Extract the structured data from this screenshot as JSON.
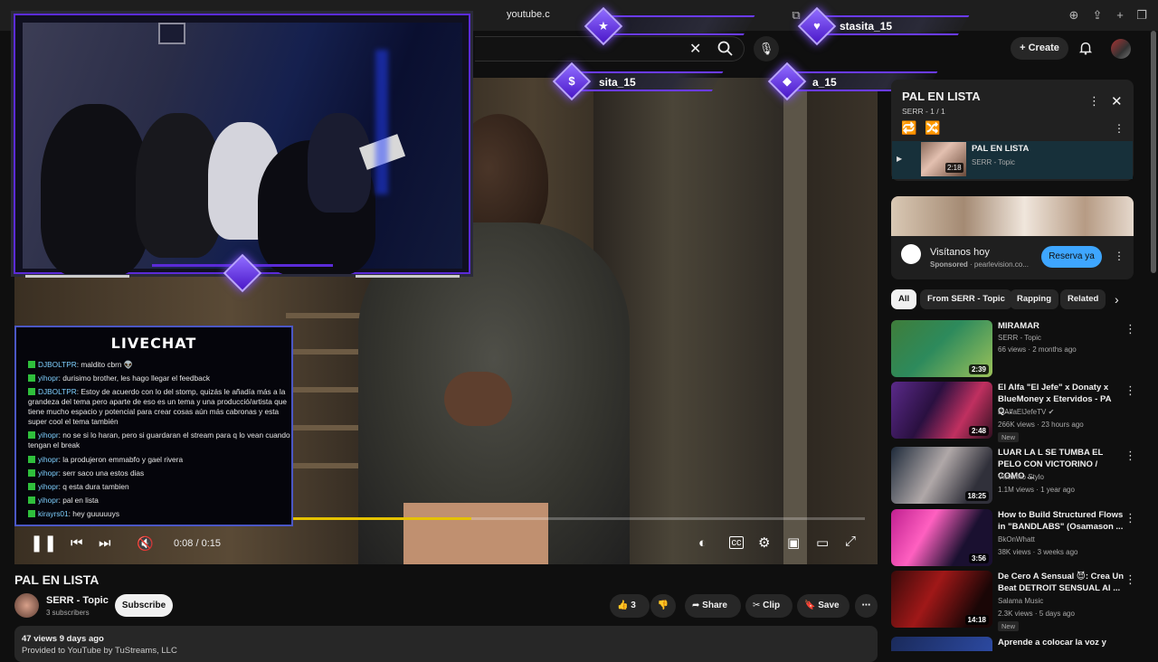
{
  "browser": {
    "url": "youtube.c"
  },
  "header": {
    "create_label": "Create"
  },
  "player": {
    "time": "0:08 / 0:15",
    "progress": 0.53
  },
  "video": {
    "title": "PAL EN LISTA",
    "channel": "SERR - Topic",
    "subscribers": "3 subscribers",
    "subscribe_label": "Subscribe",
    "likes": "3",
    "share_label": "Share",
    "clip_label": "Clip",
    "save_label": "Save",
    "desc_meta": "47 views  9 days ago",
    "desc_line": "Provided to YouTube by TuStreams, LLC"
  },
  "overlay": {
    "alerts": [
      "stasita_15",
      "sita_15",
      "a_15"
    ],
    "chat_title": "LIVECHAT",
    "chat": [
      {
        "user": "DJBOLTPR",
        "msg": "maldito cbrn 👽"
      },
      {
        "user": "yihopr",
        "msg": "durisimo brother, les hago llegar el feedback"
      },
      {
        "user": "DJBOLTPR",
        "msg": "Estoy de acuerdo con lo del stomp, quizás le añadía más a la grandeza del tema pero aparte de eso es un tema y una producció/artista que tiene mucho espacio y potencial para crear cosas aún más cabronas y esta super cool el tema también"
      },
      {
        "user": "yihopr",
        "msg": "no se si lo haran, pero si guardaran el stream para q lo vean cuando tengan el break"
      },
      {
        "user": "yihopr",
        "msg": "la produjeron emmabfo y gael rivera"
      },
      {
        "user": "yihopr",
        "msg": "serr saco una estos dias"
      },
      {
        "user": "yihopr",
        "msg": "q esta dura tambien"
      },
      {
        "user": "yihopr",
        "msg": "pal en lista"
      },
      {
        "user": "kirayrs01",
        "msg": "hey guuuuuys"
      }
    ]
  },
  "playlist": {
    "title": "PAL EN LISTA",
    "sub": "SERR - 1 / 1",
    "item_title": "PAL EN LISTA",
    "item_channel": "SERR - Topic",
    "item_duration": "2:18"
  },
  "ad": {
    "title": "Visítanos hoy",
    "sponsored": "Sponsored",
    "domain": " · pearlevision.co...",
    "cta": "Reserva ya"
  },
  "chips": [
    "All",
    "From SERR - Topic",
    "Rapping",
    "Related"
  ],
  "recommendations": [
    {
      "title": "MIRAMAR",
      "channel": "SERR - Topic",
      "meta": "66 views · 2 months ago",
      "duration": "2:39",
      "badge": ""
    },
    {
      "title": "El Alfa \"El Jefe\" x Donaty x BlueMoney x Etervidos - PA Q...",
      "channel": "ElAlfaElJefeTV ✔",
      "meta": "266K views · 23 hours ago",
      "duration": "2:48",
      "badge": "New"
    },
    {
      "title": "LUAR LA L SE TUMBA EL PELO CON VICTORINO / COMO ...",
      "channel": "Victorino Stylo",
      "meta": "1.1M views · 1 year ago",
      "duration": "18:25",
      "badge": ""
    },
    {
      "title": "How to Build Structured Flows in \"BANDLABS\" (Osamason ...",
      "channel": "BkOnWhatt",
      "meta": "38K views · 3 weeks ago",
      "duration": "3:56",
      "badge": ""
    },
    {
      "title": "De Cero A Sensual 😈: Crea Un Beat DETROIT SENSUAL AI ...",
      "channel": "Salama Music",
      "meta": "2.3K views · 5 days ago",
      "duration": "14:18",
      "badge": "New"
    },
    {
      "title": "Aprende a colocar la voz y",
      "channel": "",
      "meta": "",
      "duration": "",
      "badge": ""
    }
  ]
}
